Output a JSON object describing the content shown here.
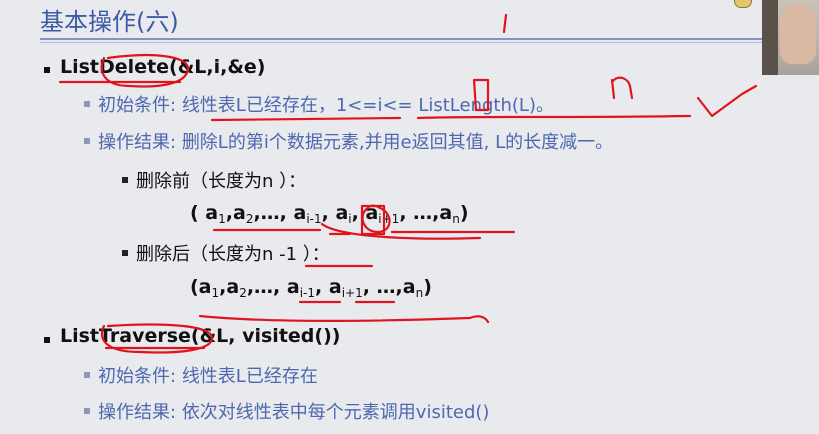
{
  "title": "基本操作(六)",
  "items": [
    {
      "head": "ListDelete(&L,i,&e)",
      "init_label": "初始条件:",
      "init_text": "线性表L已经存在，1<=i<= ListLength(L)。",
      "result_label": "操作结果:",
      "result_text": "删除L的第i个数据元素,并用e返回其值, L的长度减一。",
      "before_label": "删除前（长度为n ）：",
      "after_label": "删除后（长度为n -1 ）："
    },
    {
      "head": "ListTraverse(&L, visited())",
      "init_label": "初始条件:",
      "init_text": "线性表L已经存在",
      "result_label": "操作结果:",
      "result_text": "依次对线性表中每个元素调用visited()"
    }
  ],
  "colors": {
    "title": "#3d5aa8",
    "sub": "#4e68b0",
    "ink": "#e0141e"
  }
}
